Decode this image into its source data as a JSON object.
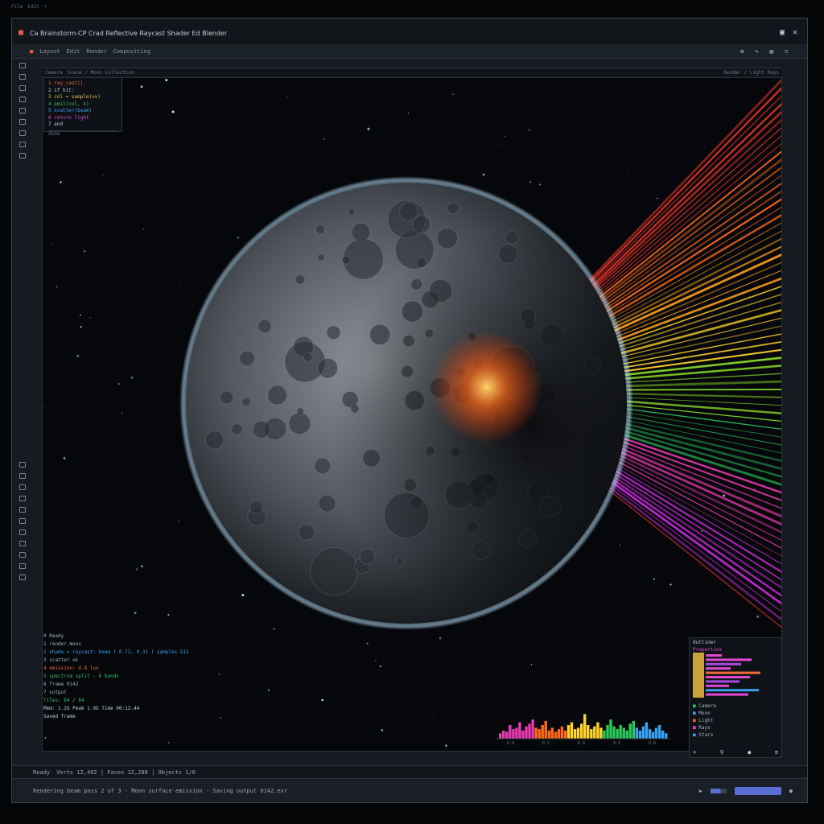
{
  "window": {
    "title": "Ca Brainstorm-CP Crad Reflective Raycast Shader Ed Blender",
    "title_icons": [
      "app-logo-icon",
      "minimize-icon",
      "maximize-icon",
      "close-icon"
    ]
  },
  "top_tiny": [
    "File",
    "Edit",
    "+"
  ],
  "toolbar": {
    "items": [
      "Layout",
      "Edit",
      "Render",
      "Compositing"
    ],
    "right_icons": [
      "gear-icon",
      "pencil-icon",
      "layers-icon",
      "copy-icon"
    ]
  },
  "viewport_header": {
    "items": [
      "Camera",
      "Scene / Moon Collection",
      "Render / Light Rays"
    ]
  },
  "code_panel": {
    "lines": [
      {
        "text": "1  ray_cast()",
        "color": "#f26b3a"
      },
      {
        "text": "2  if hit:",
        "color": "#c7d0d8"
      },
      {
        "text": "3  col = sample(uv)",
        "color": "#e2c33a"
      },
      {
        "text": "4  emit(col, k)",
        "color": "#34c06a"
      },
      {
        "text": "5  scatter(beam)",
        "color": "#3aa0f2"
      },
      {
        "text": "6  return light",
        "color": "#e04ad0"
      },
      {
        "text": "7  end",
        "color": "#c7d0d8"
      }
    ],
    "footer": "done"
  },
  "left_icons": [
    "cursor-icon",
    "move-icon",
    "rotate-icon",
    "scale-icon",
    "transform-icon",
    "annotate-icon",
    "measure-icon",
    "add-icon",
    "brush-icon",
    "knife-icon",
    "loop-icon",
    "extrude-icon",
    "inset-icon",
    "bevel-icon",
    "smooth-icon",
    "shrink-icon",
    "shear-icon",
    "rip-icon",
    "spin-icon",
    "poly-icon"
  ],
  "log": {
    "lines": [
      {
        "text": "0 Ready",
        "color": "#a8b3be"
      },
      {
        "text": "1 render.moon",
        "color": "#a8b3be"
      },
      {
        "text": "2 shade > raycast: beam ( 0.72, 0.31 ) samples 512",
        "color": "#3aa0f2"
      },
      {
        "text": "3 scatter ok",
        "color": "#a8b3be"
      },
      {
        "text": "4 emission: 4.8 lux",
        "color": "#f26b3a"
      },
      {
        "text": "5 spectrum split - 6 bands",
        "color": "#34c06a"
      },
      {
        "text": "6 frame 0142",
        "color": "#a8b3be"
      },
      {
        "text": "7 output",
        "color": "#a8b3be"
      },
      {
        "text": "   Tiles: 64 / 64",
        "color": "#34c06a"
      },
      {
        "text": "   Mem: 1.2G  Peak 1.9G  Time 00:12.44",
        "color": "#c7d0d8"
      },
      {
        "text": "   Saved frame",
        "color": "#c7d0d8"
      }
    ]
  },
  "spectrum": {
    "labels": [
      "0.0",
      "0.2",
      "0.4",
      "0.6",
      "0.8"
    ],
    "values": [
      0.2,
      0.3,
      0.25,
      0.5,
      0.35,
      0.4,
      0.6,
      0.3,
      0.45,
      0.55,
      0.7,
      0.4,
      0.35,
      0.5,
      0.65,
      0.3,
      0.4,
      0.25,
      0.35,
      0.45,
      0.3,
      0.5,
      0.6,
      0.35,
      0.4,
      0.55,
      0.9,
      0.5,
      0.35,
      0.45,
      0.6,
      0.4,
      0.3,
      0.5,
      0.7,
      0.45,
      0.35,
      0.5,
      0.4,
      0.3,
      0.55,
      0.65,
      0.4,
      0.3,
      0.45,
      0.6,
      0.35,
      0.25,
      0.4,
      0.5,
      0.3,
      0.2
    ]
  },
  "right_panel": {
    "title": "Outliner",
    "subtitle": "Properties",
    "bar_colors": [
      "#e04ad0",
      "#e04ad0",
      "#a84ae0",
      "#e04ad0",
      "#f26b3a",
      "#e04ad0",
      "#a84ae0",
      "#e04ad0",
      "#3aa0f2",
      "#e04ad0"
    ],
    "list": [
      {
        "text": "Camera",
        "color": "#34c06a"
      },
      {
        "text": "Moon",
        "color": "#3aa0f2"
      },
      {
        "text": "Light",
        "color": "#f26b3a"
      },
      {
        "text": "Rays",
        "color": "#e04ad0"
      },
      {
        "text": "Stars",
        "color": "#3aa0f2"
      }
    ]
  },
  "status": {
    "left": "Ready",
    "right": "Verts 12,402 | Faces 12,288 | Objects 1/6"
  },
  "bottom": {
    "text": "Rendering beam pass 2 of 3 - Moon surface emission - Saving output 0142.exr",
    "progress": 0.62
  },
  "colors": {
    "accent": "#5a6fd6",
    "bg": "#161b21",
    "viewport": "#05070b"
  }
}
